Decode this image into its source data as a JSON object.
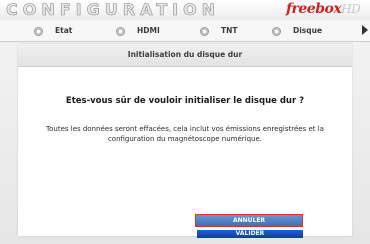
{
  "header": {
    "title": "CONFIGURATION",
    "brand": "freebox",
    "brand_suffix": "HD"
  },
  "tabs": [
    {
      "label": "Etat",
      "icon": "disc-icon"
    },
    {
      "label": "HDMI",
      "icon": "disc-icon"
    },
    {
      "label": "TNT",
      "icon": "disc-icon"
    },
    {
      "label": "Disque",
      "icon": "disc-icon"
    }
  ],
  "panel": {
    "title": "Initialisation du disque dur",
    "question": "Etes-vous sûr de vouloir initialiser le disque dur ?",
    "warning": "Toutes les données seront effacées, cela inclut vos émissions enregistrées et la configuration du magnétoscope numérique."
  },
  "buttons": {
    "cancel": "ANNULER",
    "validate": "VALIDER"
  },
  "colors": {
    "brand": "#d21f1f",
    "button": "#1b4fa6",
    "focus_border": "#e22d2d"
  }
}
